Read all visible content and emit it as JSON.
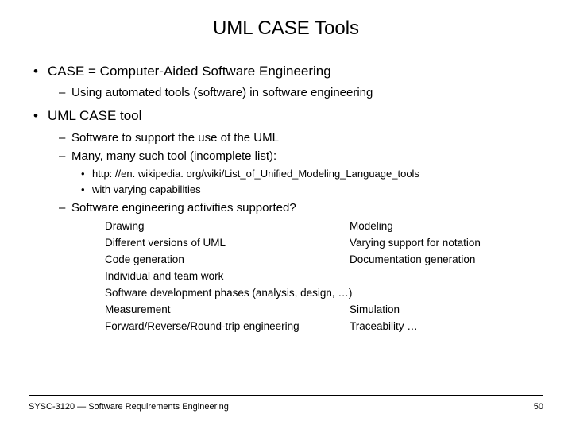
{
  "title": "UML CASE Tools",
  "bullets": {
    "case_def": "CASE = Computer-Aided Software Engineering",
    "case_sub": "Using automated tools (software) in software engineering",
    "umltool": "UML CASE tool",
    "support": "Software to support the use of the UML",
    "many_prefix": "Many, many such tool ",
    "many_paren": "(incomplete list):",
    "url": "http: //en. wikipedia. org/wiki/List_of_Unified_Modeling_Language_tools",
    "varying": "with varying capabilities",
    "activities_q": "Software engineering activities supported?"
  },
  "activities": {
    "r0c0": "Drawing",
    "r0c1": "Modeling",
    "r1c0": "Different versions of UML",
    "r1c1": "Varying support for notation",
    "r2c0": "Code generation",
    "r2c1": "Documentation generation",
    "r3": "Individual and team work",
    "r4": "Software development phases (analysis, design, …)",
    "r5c0": "Measurement",
    "r5c1": "Simulation",
    "r6c0": "Forward/Reverse/Round-trip engineering",
    "r6c1": "Traceability       …"
  },
  "footer": {
    "course": "SYSC-3120 — Software Requirements Engineering",
    "page": "50"
  }
}
